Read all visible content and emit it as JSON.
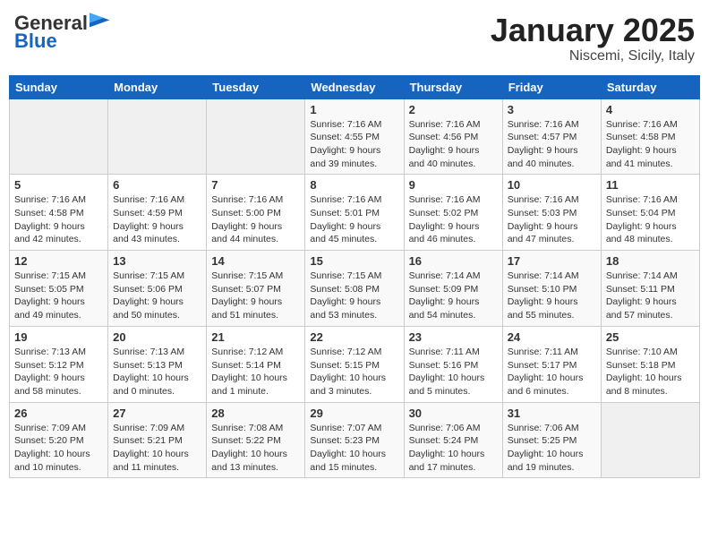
{
  "header": {
    "logo_general": "General",
    "logo_blue": "Blue",
    "month": "January 2025",
    "location": "Niscemi, Sicily, Italy"
  },
  "days_of_week": [
    "Sunday",
    "Monday",
    "Tuesday",
    "Wednesday",
    "Thursday",
    "Friday",
    "Saturday"
  ],
  "weeks": [
    [
      {
        "day": "",
        "info": ""
      },
      {
        "day": "",
        "info": ""
      },
      {
        "day": "",
        "info": ""
      },
      {
        "day": "1",
        "info": "Sunrise: 7:16 AM\nSunset: 4:55 PM\nDaylight: 9 hours\nand 39 minutes."
      },
      {
        "day": "2",
        "info": "Sunrise: 7:16 AM\nSunset: 4:56 PM\nDaylight: 9 hours\nand 40 minutes."
      },
      {
        "day": "3",
        "info": "Sunrise: 7:16 AM\nSunset: 4:57 PM\nDaylight: 9 hours\nand 40 minutes."
      },
      {
        "day": "4",
        "info": "Sunrise: 7:16 AM\nSunset: 4:58 PM\nDaylight: 9 hours\nand 41 minutes."
      }
    ],
    [
      {
        "day": "5",
        "info": "Sunrise: 7:16 AM\nSunset: 4:58 PM\nDaylight: 9 hours\nand 42 minutes."
      },
      {
        "day": "6",
        "info": "Sunrise: 7:16 AM\nSunset: 4:59 PM\nDaylight: 9 hours\nand 43 minutes."
      },
      {
        "day": "7",
        "info": "Sunrise: 7:16 AM\nSunset: 5:00 PM\nDaylight: 9 hours\nand 44 minutes."
      },
      {
        "day": "8",
        "info": "Sunrise: 7:16 AM\nSunset: 5:01 PM\nDaylight: 9 hours\nand 45 minutes."
      },
      {
        "day": "9",
        "info": "Sunrise: 7:16 AM\nSunset: 5:02 PM\nDaylight: 9 hours\nand 46 minutes."
      },
      {
        "day": "10",
        "info": "Sunrise: 7:16 AM\nSunset: 5:03 PM\nDaylight: 9 hours\nand 47 minutes."
      },
      {
        "day": "11",
        "info": "Sunrise: 7:16 AM\nSunset: 5:04 PM\nDaylight: 9 hours\nand 48 minutes."
      }
    ],
    [
      {
        "day": "12",
        "info": "Sunrise: 7:15 AM\nSunset: 5:05 PM\nDaylight: 9 hours\nand 49 minutes."
      },
      {
        "day": "13",
        "info": "Sunrise: 7:15 AM\nSunset: 5:06 PM\nDaylight: 9 hours\nand 50 minutes."
      },
      {
        "day": "14",
        "info": "Sunrise: 7:15 AM\nSunset: 5:07 PM\nDaylight: 9 hours\nand 51 minutes."
      },
      {
        "day": "15",
        "info": "Sunrise: 7:15 AM\nSunset: 5:08 PM\nDaylight: 9 hours\nand 53 minutes."
      },
      {
        "day": "16",
        "info": "Sunrise: 7:14 AM\nSunset: 5:09 PM\nDaylight: 9 hours\nand 54 minutes."
      },
      {
        "day": "17",
        "info": "Sunrise: 7:14 AM\nSunset: 5:10 PM\nDaylight: 9 hours\nand 55 minutes."
      },
      {
        "day": "18",
        "info": "Sunrise: 7:14 AM\nSunset: 5:11 PM\nDaylight: 9 hours\nand 57 minutes."
      }
    ],
    [
      {
        "day": "19",
        "info": "Sunrise: 7:13 AM\nSunset: 5:12 PM\nDaylight: 9 hours\nand 58 minutes."
      },
      {
        "day": "20",
        "info": "Sunrise: 7:13 AM\nSunset: 5:13 PM\nDaylight: 10 hours\nand 0 minutes."
      },
      {
        "day": "21",
        "info": "Sunrise: 7:12 AM\nSunset: 5:14 PM\nDaylight: 10 hours\nand 1 minute."
      },
      {
        "day": "22",
        "info": "Sunrise: 7:12 AM\nSunset: 5:15 PM\nDaylight: 10 hours\nand 3 minutes."
      },
      {
        "day": "23",
        "info": "Sunrise: 7:11 AM\nSunset: 5:16 PM\nDaylight: 10 hours\nand 5 minutes."
      },
      {
        "day": "24",
        "info": "Sunrise: 7:11 AM\nSunset: 5:17 PM\nDaylight: 10 hours\nand 6 minutes."
      },
      {
        "day": "25",
        "info": "Sunrise: 7:10 AM\nSunset: 5:18 PM\nDaylight: 10 hours\nand 8 minutes."
      }
    ],
    [
      {
        "day": "26",
        "info": "Sunrise: 7:09 AM\nSunset: 5:20 PM\nDaylight: 10 hours\nand 10 minutes."
      },
      {
        "day": "27",
        "info": "Sunrise: 7:09 AM\nSunset: 5:21 PM\nDaylight: 10 hours\nand 11 minutes."
      },
      {
        "day": "28",
        "info": "Sunrise: 7:08 AM\nSunset: 5:22 PM\nDaylight: 10 hours\nand 13 minutes."
      },
      {
        "day": "29",
        "info": "Sunrise: 7:07 AM\nSunset: 5:23 PM\nDaylight: 10 hours\nand 15 minutes."
      },
      {
        "day": "30",
        "info": "Sunrise: 7:06 AM\nSunset: 5:24 PM\nDaylight: 10 hours\nand 17 minutes."
      },
      {
        "day": "31",
        "info": "Sunrise: 7:06 AM\nSunset: 5:25 PM\nDaylight: 10 hours\nand 19 minutes."
      },
      {
        "day": "",
        "info": ""
      }
    ]
  ]
}
